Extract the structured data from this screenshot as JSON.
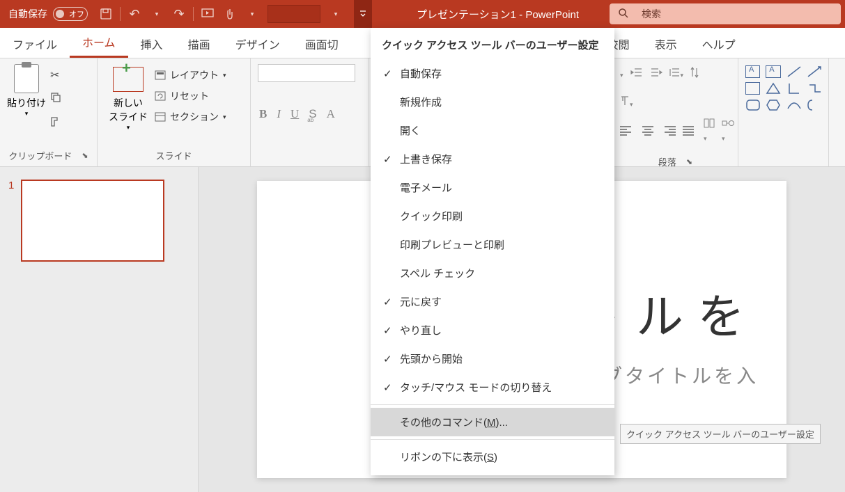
{
  "title_bar": {
    "autosave_label": "自動保存",
    "toggle_text": "オフ",
    "document_title": "プレゼンテーション1  -  PowerPoint",
    "search_placeholder": "検索"
  },
  "tabs": {
    "file": "ファイル",
    "home": "ホーム",
    "insert": "挿入",
    "draw": "描画",
    "design": "デザイン",
    "transitions": "画面切",
    "review": "校閲",
    "view": "表示",
    "help": "ヘルプ"
  },
  "ribbon": {
    "clipboard": {
      "paste": "貼り付け",
      "label": "クリップボード"
    },
    "slides": {
      "new_slide": "新しい\nスライド",
      "layout": "レイアウト",
      "reset": "リセット",
      "section": "セクション",
      "label": "スライド"
    },
    "paragraph": {
      "label": "段落"
    }
  },
  "dropdown": {
    "title": "クイック アクセス ツール バーのユーザー設定",
    "items": [
      {
        "label": "自動保存",
        "checked": true
      },
      {
        "label": "新規作成",
        "checked": false
      },
      {
        "label": "開く",
        "checked": false
      },
      {
        "label": "上書き保存",
        "checked": true
      },
      {
        "label": "電子メール",
        "checked": false
      },
      {
        "label": "クイック印刷",
        "checked": false
      },
      {
        "label": "印刷プレビューと印刷",
        "checked": false
      },
      {
        "label": "スペル チェック",
        "checked": false
      },
      {
        "label": "元に戻す",
        "checked": true
      },
      {
        "label": "やり直し",
        "checked": true
      },
      {
        "label": "先頭から開始",
        "checked": true
      },
      {
        "label": "タッチ/マウス モードの切り替え",
        "checked": true
      }
    ],
    "more_commands": "その他のコマンド(",
    "more_commands_m": "M",
    "more_commands_end": ")...",
    "show_below": "リボンの下に表示(",
    "show_below_s": "S",
    "show_below_end": ")"
  },
  "tooltip": "クイック アクセス ツール バーのユーザー設定",
  "thumbnails": {
    "num1": "1"
  },
  "slide": {
    "title_fragment": "イトルを",
    "subtitle_fragment": "サブタイトルを入"
  }
}
